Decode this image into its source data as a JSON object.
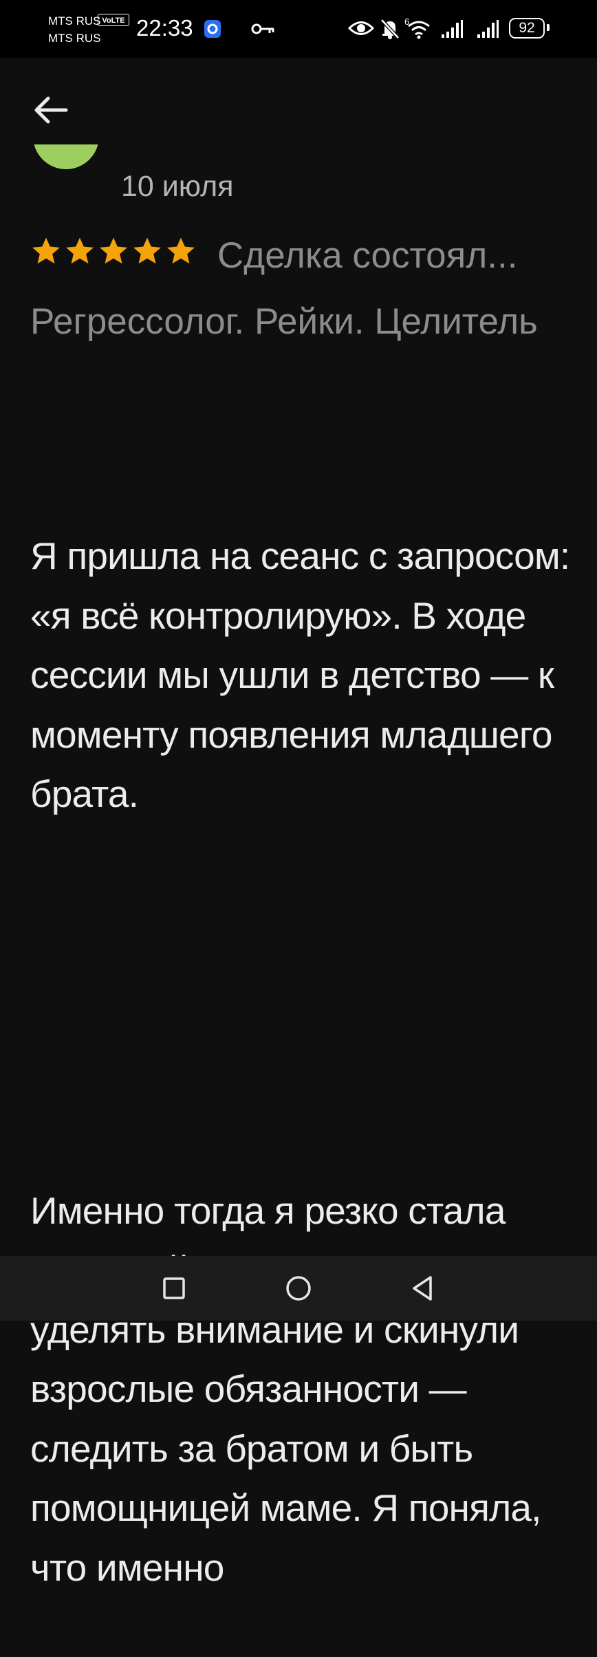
{
  "status_bar": {
    "carrier_1": "MTS RUS",
    "carrier_2": "MTS RUS",
    "volte_badge": "VoLTE",
    "time": "22:33",
    "network_type": "6",
    "battery_level": "92",
    "icons": [
      "app-notification-icon",
      "key-icon",
      "eye-icon",
      "bell-muted-icon",
      "wifi-icon",
      "signal-icon",
      "signal-icon",
      "battery-icon"
    ]
  },
  "header": {
    "back_icon": "arrow-left-icon",
    "avatar_color": "#9ccf5e",
    "date": "10 июля"
  },
  "review": {
    "rating": 5,
    "rating_max": 5,
    "star_color": "#f5a30a",
    "title": "Сделка состоялась",
    "title_visible": "Сделка состоял...",
    "subtitle": "Регрессолог. Рейки. Целитель",
    "paragraphs": [
      "Я пришла на сеанс с запросом: «я всё контролирую». В ходе сессии мы ушли в детство — к моменту появления младшего брата.",
      "Именно тогда я резко стала взрослой: мне перестали уделять внимание и скинули взрослые обязанности — следить за братом и быть помощницей маме. Я поняла, что именно"
    ]
  },
  "nav_bar": {
    "buttons": [
      "recent-apps-icon",
      "home-icon",
      "back-triangle-icon"
    ]
  }
}
